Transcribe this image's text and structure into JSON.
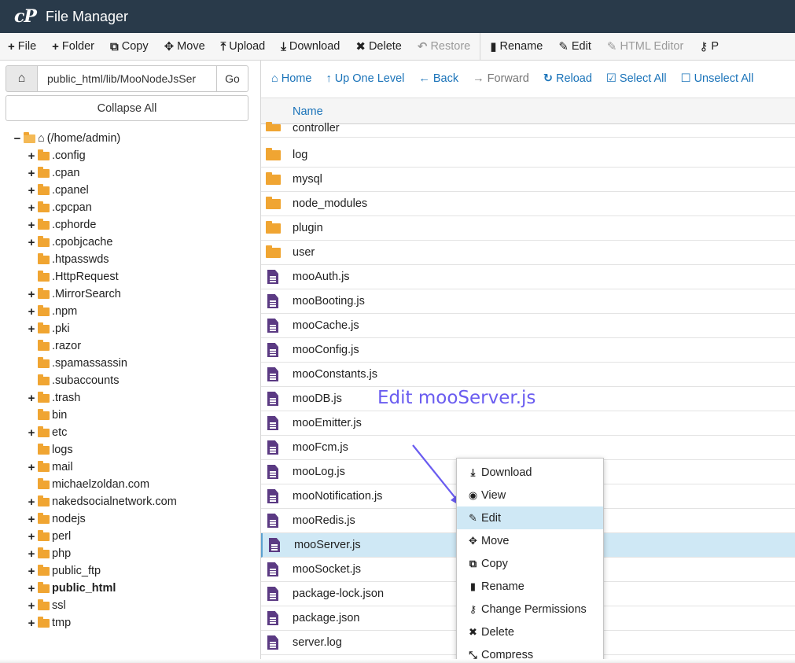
{
  "app": {
    "logo": "cP",
    "title": "File Manager"
  },
  "toolbar": {
    "items": [
      {
        "icon": "+",
        "label": "File",
        "disabled": false
      },
      {
        "icon": "+",
        "label": "Folder",
        "disabled": false
      },
      {
        "icon": "⧉",
        "label": "Copy",
        "disabled": false
      },
      {
        "icon": "✥",
        "label": "Move",
        "disabled": false
      },
      {
        "icon": "⤒",
        "label": "Upload",
        "disabled": false
      },
      {
        "icon": "⤓",
        "label": "Download",
        "disabled": false
      },
      {
        "icon": "✖",
        "label": "Delete",
        "disabled": false
      },
      {
        "icon": "↶",
        "label": "Restore",
        "disabled": true
      },
      {
        "icon": "▮",
        "label": "Rename",
        "disabled": false
      },
      {
        "icon": "✎",
        "label": "Edit",
        "disabled": false
      },
      {
        "icon": "✎",
        "label": "HTML Editor",
        "disabled": true
      },
      {
        "icon": "⚷",
        "label": "P",
        "disabled": false
      }
    ]
  },
  "left": {
    "path_value": "public_html/lib/MooNodeJsSer",
    "go_label": "Go",
    "collapse_label": "Collapse All",
    "tree": [
      {
        "label": "(/home/admin)",
        "toggle": "−",
        "home": true,
        "depth": 0
      },
      {
        "label": ".config",
        "toggle": "+",
        "depth": 1
      },
      {
        "label": ".cpan",
        "toggle": "+",
        "depth": 1
      },
      {
        "label": ".cpanel",
        "toggle": "+",
        "depth": 1
      },
      {
        "label": ".cpcpan",
        "toggle": "+",
        "depth": 1
      },
      {
        "label": ".cphorde",
        "toggle": "+",
        "depth": 1
      },
      {
        "label": ".cpobjcache",
        "toggle": "+",
        "depth": 1
      },
      {
        "label": ".htpasswds",
        "toggle": "",
        "depth": 1
      },
      {
        "label": ".HttpRequest",
        "toggle": "",
        "depth": 1
      },
      {
        "label": ".MirrorSearch",
        "toggle": "+",
        "depth": 1
      },
      {
        "label": ".npm",
        "toggle": "+",
        "depth": 1
      },
      {
        "label": ".pki",
        "toggle": "+",
        "depth": 1
      },
      {
        "label": ".razor",
        "toggle": "",
        "depth": 1
      },
      {
        "label": ".spamassassin",
        "toggle": "",
        "depth": 1
      },
      {
        "label": ".subaccounts",
        "toggle": "",
        "depth": 1
      },
      {
        "label": ".trash",
        "toggle": "+",
        "depth": 1
      },
      {
        "label": "bin",
        "toggle": "",
        "depth": 1
      },
      {
        "label": "etc",
        "toggle": "+",
        "depth": 1
      },
      {
        "label": "logs",
        "toggle": "",
        "depth": 1
      },
      {
        "label": "mail",
        "toggle": "+",
        "depth": 1
      },
      {
        "label": "michaelzoldan.com",
        "toggle": "",
        "depth": 1
      },
      {
        "label": "nakedsocialnetwork.com",
        "toggle": "+",
        "depth": 1
      },
      {
        "label": "nodejs",
        "toggle": "+",
        "depth": 1
      },
      {
        "label": "perl",
        "toggle": "+",
        "depth": 1
      },
      {
        "label": "php",
        "toggle": "+",
        "depth": 1
      },
      {
        "label": "public_ftp",
        "toggle": "+",
        "depth": 1
      },
      {
        "label": "public_html",
        "toggle": "+",
        "depth": 1,
        "bold": true
      },
      {
        "label": "ssl",
        "toggle": "+",
        "depth": 1
      },
      {
        "label": "tmp",
        "toggle": "+",
        "depth": 1
      }
    ]
  },
  "nav": {
    "items": [
      {
        "icon": "⌂",
        "label": "Home",
        "disabled": false
      },
      {
        "icon": "↑",
        "label": "Up One Level",
        "disabled": false
      },
      {
        "icon": "←",
        "label": "Back",
        "disabled": false
      },
      {
        "icon": "→",
        "label": "Forward",
        "disabled": true
      },
      {
        "icon": "↻",
        "label": "Reload",
        "disabled": false
      },
      {
        "icon": "☑",
        "label": "Select All",
        "disabled": false
      },
      {
        "icon": "☐",
        "label": "Unselect All",
        "disabled": false
      }
    ]
  },
  "table": {
    "header_name": "Name",
    "rows": [
      {
        "name": "controller",
        "type": "folder"
      },
      {
        "name": "log",
        "type": "folder"
      },
      {
        "name": "mysql",
        "type": "folder"
      },
      {
        "name": "node_modules",
        "type": "folder"
      },
      {
        "name": "plugin",
        "type": "folder"
      },
      {
        "name": "user",
        "type": "folder"
      },
      {
        "name": "mooAuth.js",
        "type": "file"
      },
      {
        "name": "mooBooting.js",
        "type": "file"
      },
      {
        "name": "mooCache.js",
        "type": "file"
      },
      {
        "name": "mooConfig.js",
        "type": "file"
      },
      {
        "name": "mooConstants.js",
        "type": "file"
      },
      {
        "name": "mooDB.js",
        "type": "file"
      },
      {
        "name": "mooEmitter.js",
        "type": "file"
      },
      {
        "name": "mooFcm.js",
        "type": "file"
      },
      {
        "name": "mooLog.js",
        "type": "file"
      },
      {
        "name": "mooNotification.js",
        "type": "file"
      },
      {
        "name": "mooRedis.js",
        "type": "file"
      },
      {
        "name": "mooServer.js",
        "type": "file",
        "selected": true
      },
      {
        "name": "mooSocket.js",
        "type": "file"
      },
      {
        "name": "package-lock.json",
        "type": "file"
      },
      {
        "name": "package.json",
        "type": "file"
      },
      {
        "name": "server.log",
        "type": "file"
      }
    ]
  },
  "annotation": {
    "text": "Edit mooServer.js",
    "color": "#6a5cf0"
  },
  "context_menu": {
    "items": [
      {
        "icon": "⤓",
        "label": "Download"
      },
      {
        "icon": "◉",
        "label": "View"
      },
      {
        "icon": "✎",
        "label": "Edit",
        "hover": true
      },
      {
        "icon": "✥",
        "label": "Move"
      },
      {
        "icon": "⧉",
        "label": "Copy"
      },
      {
        "icon": "▮",
        "label": "Rename"
      },
      {
        "icon": "⚷",
        "label": "Change Permissions"
      },
      {
        "icon": "✖",
        "label": "Delete"
      },
      {
        "icon": "⤡",
        "label": "Compress"
      }
    ]
  },
  "colors": {
    "titlebar": "#293a4a",
    "link": "#1a73b9",
    "folder": "#f0a532",
    "file": "#5b3a83",
    "selected_row": "#cfe8f5"
  }
}
